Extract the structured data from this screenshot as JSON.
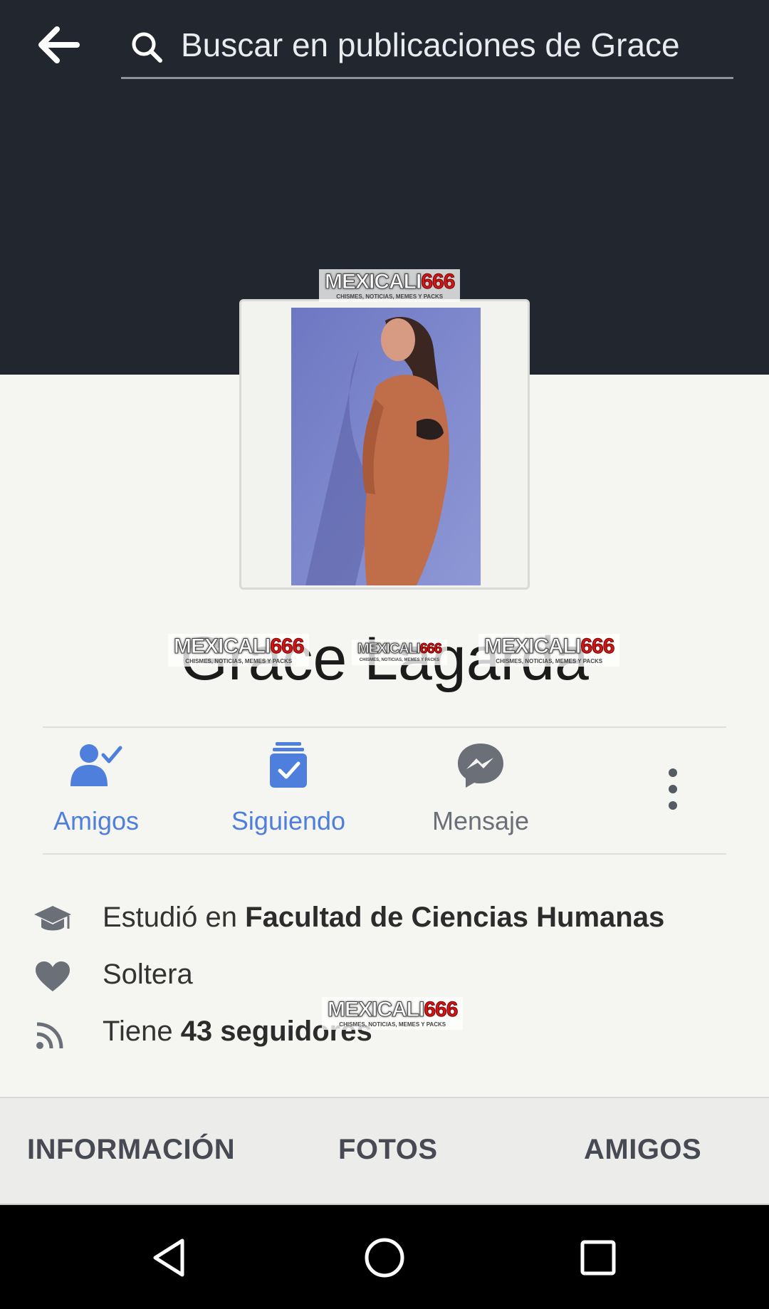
{
  "search": {
    "placeholder": "Buscar en publicaciones de Grace"
  },
  "profile": {
    "name": "Grace Lagarda"
  },
  "watermark": {
    "brand_a": "MEXICALI",
    "brand_b": "666",
    "tagline": "CHISMES, NOTICIAS, MEMES Y PACKS"
  },
  "actions": [
    {
      "label": "Amigos",
      "icon": "friends-check-icon"
    },
    {
      "label": "Siguiendo",
      "icon": "following-check-icon"
    },
    {
      "label": "Mensaje",
      "icon": "messenger-icon"
    }
  ],
  "info": {
    "education_prefix": "Estudió en ",
    "education_place": "Facultad de Ciencias Humanas",
    "relationship": "Soltera",
    "followers_prefix": "Tiene ",
    "followers_value": "43 seguidores"
  },
  "tabs": [
    "INFORMACIÓN",
    "FOTOS",
    "AMIGOS"
  ],
  "colors": {
    "cover": "#22262f",
    "accent": "#4f7fdc",
    "page_bg": "#f5f5f1"
  }
}
